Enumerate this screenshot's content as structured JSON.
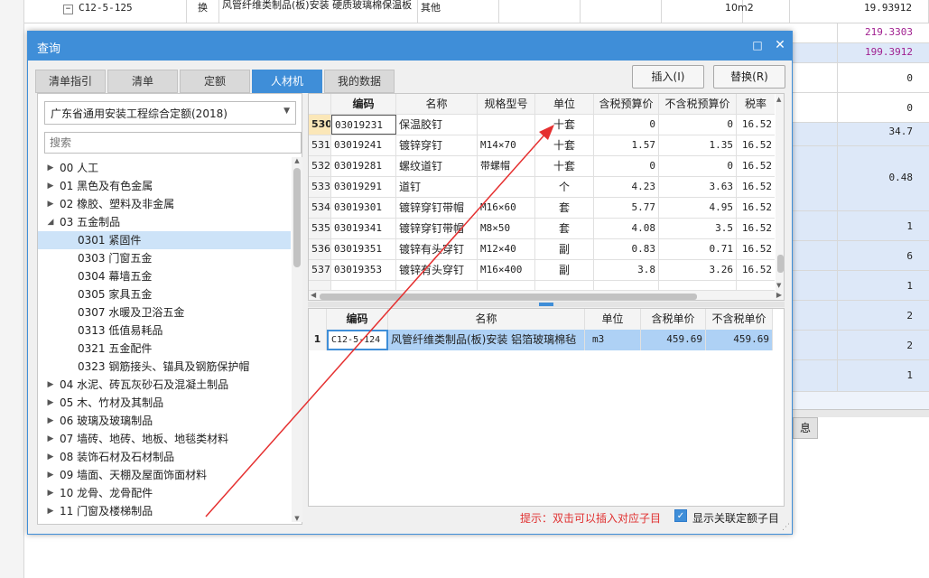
{
  "background": {
    "rows": [
      {
        "code": "C12-5-125",
        "type": "换",
        "name": "风管纤维类制品(板)安装 硬质玻璃棉保温板",
        "category": "其他",
        "unit": "10m2",
        "value": "19.93912"
      },
      {
        "code": "",
        "type": "",
        "name": "",
        "category": "",
        "unit": "",
        "value": "219.3303"
      },
      {
        "code": "",
        "type": "",
        "name": "",
        "category": "",
        "unit": "",
        "value": "199.3912"
      }
    ],
    "right_values": [
      "0",
      "0",
      "34.7",
      "0.48",
      "1",
      "6",
      "1",
      "2",
      "2",
      "1"
    ],
    "bottom_tab": "息"
  },
  "dialog": {
    "title": "查询",
    "maximize_icon": "□",
    "close_icon": "✕",
    "tabs": [
      "清单指引",
      "清单",
      "定额",
      "人材机",
      "我的数据"
    ],
    "active_tab": "人材机",
    "insert_label": "插入(I)",
    "replace_label": "替换(R)",
    "quota_library": "广东省通用安装工程综合定额(2018)",
    "search_placeholder": "搜索",
    "tree": [
      {
        "label": "00 人工",
        "level": 0,
        "state": "collapsed"
      },
      {
        "label": "01 黑色及有色金属",
        "level": 0,
        "state": "collapsed"
      },
      {
        "label": "02 橡胶、塑料及非金属",
        "level": 0,
        "state": "collapsed"
      },
      {
        "label": "03 五金制品",
        "level": 0,
        "state": "expanded"
      },
      {
        "label": "0301 紧固件",
        "level": 1,
        "state": "leaf",
        "selected": true
      },
      {
        "label": "0303 门窗五金",
        "level": 1,
        "state": "leaf"
      },
      {
        "label": "0304 幕墙五金",
        "level": 1,
        "state": "leaf"
      },
      {
        "label": "0305 家具五金",
        "level": 1,
        "state": "leaf"
      },
      {
        "label": "0307 水暖及卫浴五金",
        "level": 1,
        "state": "leaf"
      },
      {
        "label": "0313 低值易耗品",
        "level": 1,
        "state": "leaf"
      },
      {
        "label": "0321 五金配件",
        "level": 1,
        "state": "leaf"
      },
      {
        "label": "0323 钢筋接头、锚具及钢筋保护帽",
        "level": 1,
        "state": "leaf"
      },
      {
        "label": "04 水泥、砖瓦灰砂石及混凝土制品",
        "level": 0,
        "state": "collapsed"
      },
      {
        "label": "05 木、竹材及其制品",
        "level": 0,
        "state": "collapsed"
      },
      {
        "label": "06 玻璃及玻璃制品",
        "level": 0,
        "state": "collapsed"
      },
      {
        "label": "07 墙砖、地砖、地板、地毯类材料",
        "level": 0,
        "state": "collapsed"
      },
      {
        "label": "08 装饰石材及石材制品",
        "level": 0,
        "state": "collapsed"
      },
      {
        "label": "09 墙面、天棚及屋面饰面材料",
        "level": 0,
        "state": "collapsed"
      },
      {
        "label": "10 龙骨、龙骨配件",
        "level": 0,
        "state": "collapsed"
      },
      {
        "label": "11 门窗及楼梯制品",
        "level": 0,
        "state": "collapsed"
      }
    ],
    "material_table": {
      "headers": [
        "编码",
        "名称",
        "规格型号",
        "单位",
        "含税预算价",
        "不含税预算价",
        "税率"
      ],
      "rows": [
        {
          "num": "530",
          "code": "03019231",
          "name": "保温胶钉",
          "spec": "",
          "unit": "十套",
          "price_tax": "0",
          "price_notax": "0",
          "rate": "16.52"
        },
        {
          "num": "531",
          "code": "03019241",
          "name": "镀锌穿钉",
          "spec": "M14×70",
          "unit": "十套",
          "price_tax": "1.57",
          "price_notax": "1.35",
          "rate": "16.52"
        },
        {
          "num": "532",
          "code": "03019281",
          "name": "螺纹道钉",
          "spec": "带螺帽",
          "unit": "十套",
          "price_tax": "0",
          "price_notax": "0",
          "rate": "16.52"
        },
        {
          "num": "533",
          "code": "03019291",
          "name": "道钉",
          "spec": "",
          "unit": "个",
          "price_tax": "4.23",
          "price_notax": "3.63",
          "rate": "16.52"
        },
        {
          "num": "534",
          "code": "03019301",
          "name": "镀锌穿钉带帽",
          "spec": "M16×60",
          "unit": "套",
          "price_tax": "5.77",
          "price_notax": "4.95",
          "rate": "16.52"
        },
        {
          "num": "535",
          "code": "03019341",
          "name": "镀锌穿钉带帽",
          "spec": "M8×50",
          "unit": "套",
          "price_tax": "4.08",
          "price_notax": "3.5",
          "rate": "16.52"
        },
        {
          "num": "536",
          "code": "03019351",
          "name": "镀锌有头穿钉",
          "spec": "M12×40",
          "unit": "副",
          "price_tax": "0.83",
          "price_notax": "0.71",
          "rate": "16.52"
        },
        {
          "num": "537",
          "code": "03019353",
          "name": "镀锌有头穿钉",
          "spec": "M16×400",
          "unit": "副",
          "price_tax": "3.8",
          "price_notax": "3.26",
          "rate": "16.52"
        }
      ]
    },
    "linked_table": {
      "headers": [
        "编码",
        "名称",
        "单位",
        "含税单价",
        "不含税单价"
      ],
      "rows": [
        {
          "num": "1",
          "code": "C12-5-124",
          "name": "风管纤维类制品(板)安装 铝箔玻璃棉毡",
          "unit": "m3",
          "price_tax": "459.69",
          "price_notax": "459.69"
        }
      ]
    },
    "hint": "提示：双击可以插入对应子目",
    "show_linked_label": "显示关联定额子目",
    "show_linked_checked": true
  },
  "colors": {
    "accent": "#3f8ed8",
    "selection": "#aed1f5",
    "tree_selection": "#cde3f8",
    "annotation_arrow": "#e53030",
    "hint_text": "#e03030"
  }
}
